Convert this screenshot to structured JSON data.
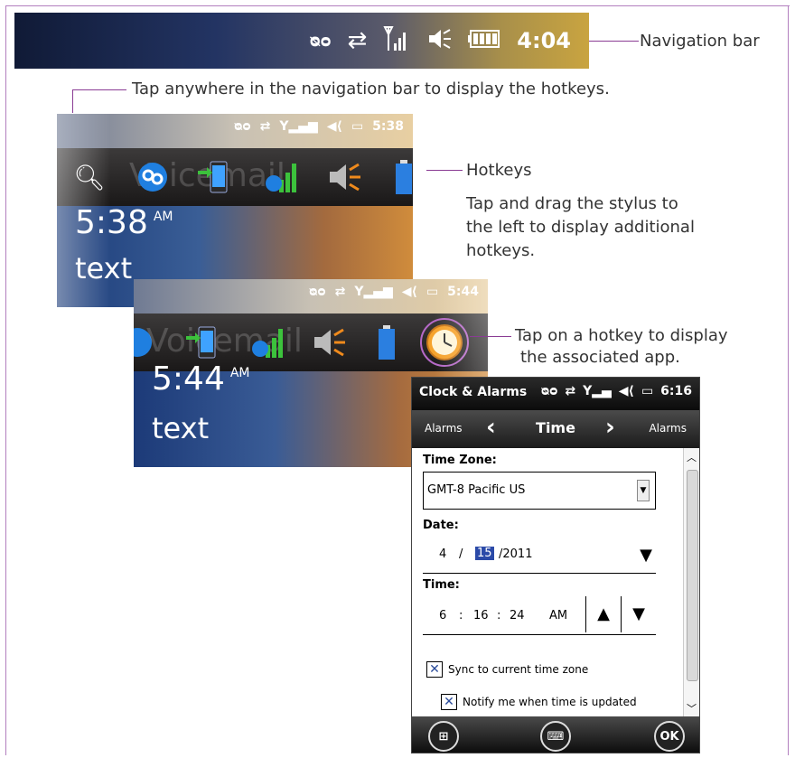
{
  "callouts": {
    "navigation_bar": "Navigation bar",
    "tap_anywhere": "Tap anywhere in the navigation bar to display the hotkeys.",
    "hotkeys": "Hotkeys",
    "drag_line1": "Tap and drag the stylus to",
    "drag_line2": "the left to display additional",
    "drag_line3": "hotkeys.",
    "tap_hotkey_line1": "Tap on a hotkey to display",
    "tap_hotkey_line2": "the associated app."
  },
  "navbar": {
    "clock": "4:04"
  },
  "screenshot1": {
    "clock": "5:38",
    "home_time": "5:38",
    "ampm": "AM",
    "text": "text",
    "faded_label": "Voicemail"
  },
  "screenshot2": {
    "clock": "5:44",
    "home_time": "5:44",
    "ampm": "AM",
    "text": "text",
    "faded_label": "Voicemail"
  },
  "device": {
    "title": "Clock & Alarms",
    "clock": "6:16",
    "nav_left": "Alarms",
    "nav_center": "Time",
    "nav_right": "Alarms",
    "time_zone_label": "Time Zone:",
    "time_zone_value": "GMT-8 Pacific US",
    "date_label": "Date:",
    "date_month": "4",
    "date_sep1": "/",
    "date_day": "15",
    "date_year": "/2011",
    "time_label": "Time:",
    "time_hour": "6",
    "time_min": "16",
    "time_sec": "24",
    "time_ampm": "AM",
    "time_sep": ":",
    "sync_label": "Sync to current time zone",
    "notify_label": "Notify me when time is updated",
    "ok_label": "OK"
  },
  "colors": {
    "accent": "#8a3c94"
  }
}
